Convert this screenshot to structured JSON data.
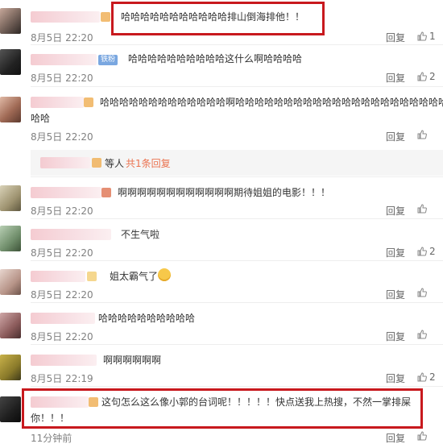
{
  "comments": [
    {
      "text": "哈哈哈哈哈哈哈哈哈哈哈排山倒海排他！！",
      "date": "8月5日 22:20",
      "reply": "回复",
      "likes": "1"
    },
    {
      "text": "哈哈哈哈哈哈哈哈哈哈这什么啊哈哈哈哈",
      "date": "8月5日 22:20",
      "reply": "回复",
      "likes": "2",
      "badge": "铁粉"
    },
    {
      "text_line1": "哈哈哈哈哈哈哈哈哈哈哈哈哈啊哈哈哈哈哈哈哈哈哈哈哈哈哈哈哈哈哈哈哈哈哈哈",
      "text_line2": "哈哈",
      "date": "8月5日 22:20",
      "reply": "回复",
      "likes": ""
    },
    {
      "text": "啊啊啊啊啊啊啊啊啊啊啊啊期待姐姐的电影！！！",
      "date": "8月5日 22:20",
      "reply": "回复",
      "likes": ""
    },
    {
      "text": "不生气啦",
      "date": "8月5日 22:20",
      "reply": "回复",
      "likes": "2"
    },
    {
      "text": "姐太霸气了",
      "date": "8月5日 22:20",
      "reply": "回复",
      "likes": ""
    },
    {
      "text": "哈哈哈哈哈哈哈哈哈哈",
      "date": "8月5日 22:20",
      "reply": "回复",
      "likes": ""
    },
    {
      "text": "啊啊啊啊啊啊",
      "date": "8月5日 22:19",
      "reply": "回复",
      "likes": "2"
    },
    {
      "text_line1": "这句怎么这么像小郭的台词呢！！！！！快点送我上热搜，不然一掌排屎",
      "text_line2": "你！！！",
      "date": "11分钟前",
      "reply": "回复",
      "likes": ""
    }
  ],
  "sub_reply": {
    "prefix": "等人",
    "link": "共1条回复"
  },
  "colors": {
    "highlight_box": "#c8191e",
    "link": "#eb7350",
    "muted": "#808080"
  }
}
